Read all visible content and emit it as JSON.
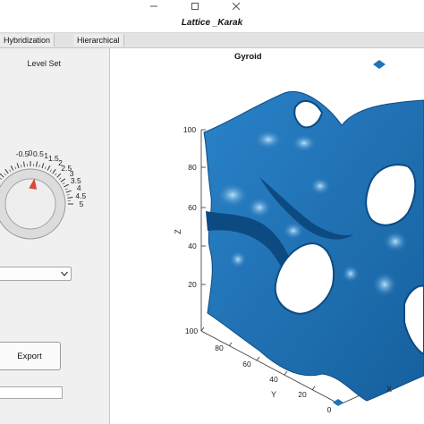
{
  "window": {
    "title": "Lattice _Karak"
  },
  "tabs": [
    {
      "label": "Hybridization"
    },
    {
      "label": "Hierarchical"
    }
  ],
  "knob": {
    "label": "Level Set",
    "ticks": [
      "-0.5",
      "0",
      "0.5",
      "1",
      "1.5",
      "2",
      "2.5",
      "3",
      "3.5",
      "4",
      "4.5",
      "5"
    ],
    "value": 0.5,
    "min": -5,
    "max": 5
  },
  "controls": {
    "export_label": "Export"
  },
  "plot": {
    "title": "Gyroid",
    "z_label": "Z",
    "x_label": "X",
    "y_label": "Y",
    "z_ticks": [
      "100",
      "80",
      "60",
      "40",
      "20"
    ],
    "y_ticks": [
      "100",
      "80",
      "60",
      "40",
      "20",
      "0"
    ],
    "surface_color": "#1f73b8",
    "surface_dark": "#0d4a82",
    "highlight_color": "#8fd0ff"
  },
  "colors": {
    "pointer": "#d64a3a",
    "accent_icon": "#1f73b8"
  }
}
